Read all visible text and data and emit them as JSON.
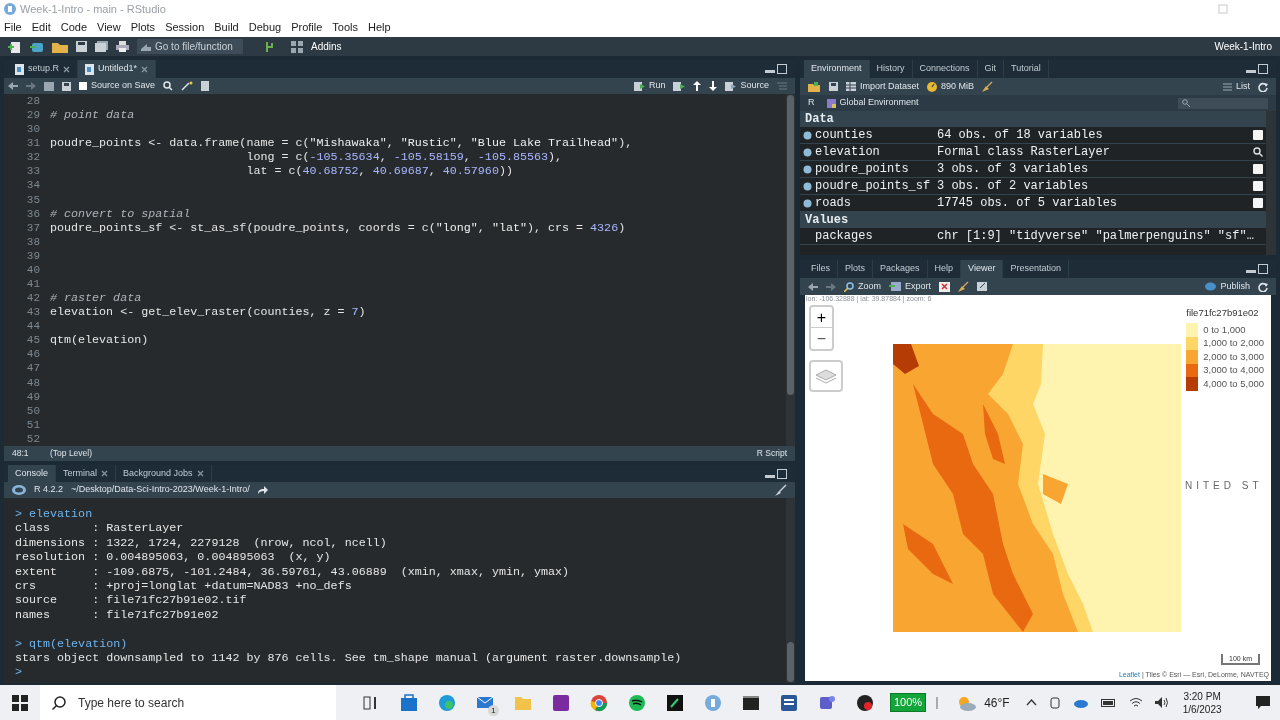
{
  "window": {
    "title": "Week-1-Intro - main - RStudio"
  },
  "menu": [
    "File",
    "Edit",
    "Code",
    "View",
    "Plots",
    "Session",
    "Build",
    "Debug",
    "Profile",
    "Tools",
    "Help"
  ],
  "toolbar": {
    "goto_placeholder": "Go to file/function",
    "addins": "Addins",
    "project": "Week-1-Intro"
  },
  "editor": {
    "tabs": [
      {
        "label": "setup.R",
        "selected": false
      },
      {
        "label": "Untitled1*",
        "selected": true
      }
    ],
    "source_on_save": "Source on Save",
    "source_on_save_checked": false,
    "run": "Run",
    "source": "Source",
    "lines": [
      {
        "number": "28"
      },
      {
        "number": "29",
        "tokens": [
          {
            "kind": "comment",
            "text": "# point data"
          }
        ]
      },
      {
        "number": "30"
      },
      {
        "number": "31",
        "tokens": [
          {
            "kind": "code",
            "text": "poudre_points <- data.frame(name = c("
          },
          {
            "kind": "string",
            "text": "\"Mishawaka\""
          },
          {
            "kind": "code",
            "text": ", "
          },
          {
            "kind": "string",
            "text": "\"Rustic\""
          },
          {
            "kind": "code",
            "text": ", "
          },
          {
            "kind": "string",
            "text": "\"Blue Lake Trailhead\""
          },
          {
            "kind": "code",
            "text": "),"
          }
        ]
      },
      {
        "number": "32",
        "tokens": [
          {
            "kind": "code",
            "text": "                            long = c("
          },
          {
            "kind": "number",
            "text": "-105.35634"
          },
          {
            "kind": "code",
            "text": ", "
          },
          {
            "kind": "number",
            "text": "-105.58159"
          },
          {
            "kind": "code",
            "text": ", "
          },
          {
            "kind": "number",
            "text": "-105.85563"
          },
          {
            "kind": "code",
            "text": "),"
          }
        ]
      },
      {
        "number": "33",
        "tokens": [
          {
            "kind": "code",
            "text": "                            lat = c("
          },
          {
            "kind": "number",
            "text": "40.68752"
          },
          {
            "kind": "code",
            "text": ", "
          },
          {
            "kind": "number",
            "text": "40.69687"
          },
          {
            "kind": "code",
            "text": ", "
          },
          {
            "kind": "number",
            "text": "40.57960"
          },
          {
            "kind": "code",
            "text": "))"
          }
        ]
      },
      {
        "number": "34"
      },
      {
        "number": "35"
      },
      {
        "number": "36",
        "tokens": [
          {
            "kind": "comment",
            "text": "# convert to spatial"
          }
        ]
      },
      {
        "number": "37",
        "tokens": [
          {
            "kind": "code",
            "text": "poudre_points_sf <- st_as_sf(poudre_points, coords = c("
          },
          {
            "kind": "string",
            "text": "\"long\""
          },
          {
            "kind": "code",
            "text": ", "
          },
          {
            "kind": "string",
            "text": "\"lat\""
          },
          {
            "kind": "code",
            "text": "), crs = "
          },
          {
            "kind": "number",
            "text": "4326"
          },
          {
            "kind": "code",
            "text": ")"
          }
        ]
      },
      {
        "number": "38"
      },
      {
        "number": "39"
      },
      {
        "number": "40"
      },
      {
        "number": "41"
      },
      {
        "number": "42",
        "tokens": [
          {
            "kind": "comment",
            "text": "# raster data"
          }
        ]
      },
      {
        "number": "43",
        "tokens": [
          {
            "kind": "code",
            "text": "elevation <- get_elev_raster(counties, z = "
          },
          {
            "kind": "number",
            "text": "7"
          },
          {
            "kind": "code",
            "text": ")"
          }
        ]
      },
      {
        "number": "44"
      },
      {
        "number": "45",
        "tokens": [
          {
            "kind": "code",
            "text": "qtm(elevation)"
          }
        ]
      },
      {
        "number": "46"
      },
      {
        "number": "47"
      },
      {
        "number": "48"
      },
      {
        "number": "49"
      },
      {
        "number": "50"
      },
      {
        "number": "51"
      },
      {
        "number": "52"
      }
    ],
    "status": {
      "position": "48:1",
      "scope": "(Top Level)",
      "file_type": "R Script"
    }
  },
  "console": {
    "tabs": [
      {
        "label": "Console",
        "selected": true,
        "closable": false
      },
      {
        "label": "Terminal",
        "selected": false,
        "closable": true
      },
      {
        "label": "Background Jobs",
        "selected": false,
        "closable": true
      }
    ],
    "version": "R 4.2.2",
    "path": "~/Desktop/Data-Sci-Intro-2023/Week-1-Intro/",
    "lines": [
      {
        "kind": "input",
        "text": "> elevation"
      },
      {
        "kind": "output",
        "text": "class      : RasterLayer"
      },
      {
        "kind": "output",
        "text": "dimensions : 1322, 1724, 2279128  (nrow, ncol, ncell)"
      },
      {
        "kind": "output",
        "text": "resolution : 0.004895063, 0.004895063  (x, y)"
      },
      {
        "kind": "output",
        "text": "extent     : -109.6875, -101.2484, 36.59761, 43.06889  (xmin, xmax, ymin, ymax)"
      },
      {
        "kind": "output",
        "text": "crs        : +proj=longlat +datum=NAD83 +no_defs"
      },
      {
        "kind": "output",
        "text": "source     : file71fc27b91e02.tif"
      },
      {
        "kind": "output",
        "text": "names      : file71fc27b91e02"
      },
      {
        "kind": "blank"
      },
      {
        "kind": "input",
        "text": "> qtm(elevation)"
      },
      {
        "kind": "output",
        "text": "stars object downsampled to 1142 by 876 cells. See tm_shape manual (argument raster.downsample)"
      },
      {
        "kind": "input",
        "text": ">"
      }
    ]
  },
  "environment": {
    "tabs": [
      {
        "label": "Environment",
        "selected": true
      },
      {
        "label": "History",
        "selected": false
      },
      {
        "label": "Connections",
        "selected": false
      },
      {
        "label": "Git",
        "selected": false
      },
      {
        "label": "Tutorial",
        "selected": false
      }
    ],
    "import": "Import Dataset",
    "memory": "890 MiB",
    "view": "List",
    "language": "R",
    "scope": "Global Environment",
    "sections": [
      {
        "title": "Data",
        "rows": [
          {
            "name": "counties",
            "value": "64 obs. of 18 variables",
            "kind": "table"
          },
          {
            "name": "elevation",
            "value": "Formal class  RasterLayer",
            "kind": "search"
          },
          {
            "name": "poudre_points",
            "value": "3 obs. of 3 variables",
            "kind": "table"
          },
          {
            "name": "poudre_points_sf",
            "value": "3 obs. of 2 variables",
            "kind": "table"
          },
          {
            "name": "roads",
            "value": "17745 obs. of 5 variables",
            "kind": "table"
          }
        ]
      },
      {
        "title": "Values",
        "rows": [
          {
            "name": "packages",
            "value": "chr [1:9] \"tidyverse\" \"palmerpenguins\" \"sf\"…"
          }
        ]
      }
    ]
  },
  "viewer": {
    "tabs": [
      {
        "label": "Files",
        "selected": false
      },
      {
        "label": "Plots",
        "selected": false
      },
      {
        "label": "Packages",
        "selected": false
      },
      {
        "label": "Help",
        "selected": false
      },
      {
        "label": "Viewer",
        "selected": true
      },
      {
        "label": "Presentation",
        "selected": false
      }
    ],
    "zoom": "Zoom",
    "export": "Export",
    "publish": "Publish",
    "map": {
      "coordinates": "lon: -106.32888 | lat: 39.87884 | zoom: 6",
      "zoom_in": "+",
      "zoom_out": "−",
      "place_label": "NITED ST",
      "scale": "100 km",
      "attribution_link": "Leaflet",
      "attribution": "| Tiles © Esri — Esri, DeLorme, NAVTEQ",
      "legend": {
        "title": "file71fc27b91e02",
        "items": [
          {
            "label": "0 to 1,000",
            "color": "#fff3b0"
          },
          {
            "label": "1,000 to 2,000",
            "color": "#fed666"
          },
          {
            "label": "2,000 to 3,000",
            "color": "#f9a531"
          },
          {
            "label": "3,000 to 4,000",
            "color": "#e8690f"
          },
          {
            "label": "4,000 to 5,000",
            "color": "#b63c05"
          }
        ]
      }
    }
  },
  "taskbar": {
    "search_placeholder": "Type here to search",
    "mail_badge": "1",
    "battery": "100%",
    "temperature": "46°F",
    "time": "3:20 PM",
    "date": "1/6/2023"
  }
}
